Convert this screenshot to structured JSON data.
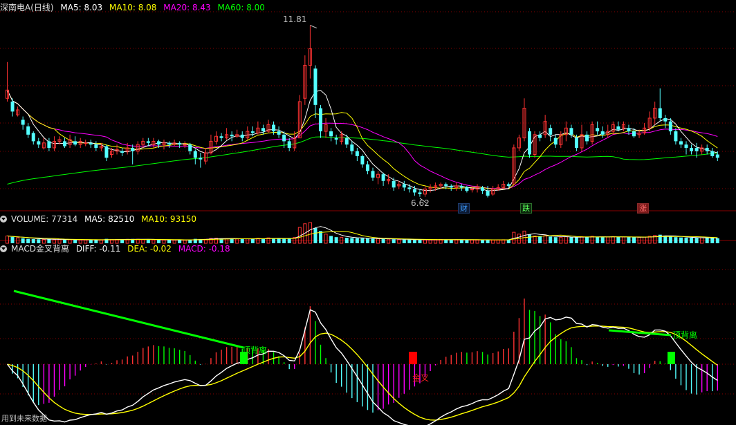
{
  "headers": {
    "kline": {
      "title": "深南电A(日线)",
      "ma5": "MA5: 8.03",
      "ma10": "MA10: 8.08",
      "ma20": "MA20: 8.43",
      "ma60": "MA60: 8.00"
    },
    "volume": {
      "title": "VOLUME: 77314",
      "ma5": "MA5: 82510",
      "ma10": "MA10: 93150"
    },
    "macd": {
      "title": "MACD金叉背离",
      "diff": "DIFF: -0.11",
      "dea": "DEA: -0.02",
      "macd": "MACD: -0.18"
    }
  },
  "annotations": {
    "high": "11.81",
    "low": "6.62",
    "tag_cai": "财",
    "tag_die": "跌",
    "tag_zhang": "涨",
    "top_divergence_1": "顶背离",
    "top_divergence_2": "顶背离",
    "golden_cross": "金叉"
  },
  "footer": "用到未来数据",
  "colors": {
    "up": "#ff3232",
    "down": "#54ffff",
    "ma5": "#ffffff",
    "ma10": "#ffff00",
    "ma20": "#ff00ff",
    "ma60": "#00ff00",
    "grid": "#8b0000",
    "divergence": "#00ff00",
    "golden_cross": "#ff0000"
  },
  "chart_data": {
    "type": "candlestick",
    "price_range": [
      6.3,
      12.2
    ],
    "candles": [
      [
        9.6,
        9.85,
        10.7,
        9.5
      ],
      [
        9.5,
        9.2,
        9.6,
        9.05
      ],
      [
        9.1,
        9.25,
        9.35,
        9.05
      ],
      [
        8.95,
        8.8,
        9.05,
        8.65
      ],
      [
        8.75,
        8.5,
        8.85,
        8.4
      ],
      [
        8.55,
        8.3,
        8.6,
        8.2
      ],
      [
        8.3,
        8.2,
        8.4,
        8.1
      ],
      [
        8.1,
        8.25,
        8.4,
        8.05
      ],
      [
        8.3,
        8.1,
        8.4,
        8.0
      ],
      [
        8.1,
        8.3,
        8.45,
        8.0
      ],
      [
        8.3,
        8.35,
        8.45,
        8.2
      ],
      [
        8.3,
        8.15,
        8.4,
        8.1
      ],
      [
        8.2,
        8.35,
        8.5,
        8.1
      ],
      [
        8.3,
        8.2,
        8.45,
        8.15
      ],
      [
        8.2,
        8.3,
        8.4,
        8.1
      ],
      [
        8.25,
        8.25,
        8.35,
        8.15
      ],
      [
        8.25,
        8.2,
        8.35,
        8.1
      ],
      [
        8.2,
        8.1,
        8.3,
        8.0
      ],
      [
        8.1,
        8.15,
        8.25,
        8.0
      ],
      [
        8.15,
        7.8,
        8.2,
        7.7
      ],
      [
        7.9,
        8.0,
        8.1,
        7.8
      ],
      [
        8.0,
        8.05,
        8.2,
        7.9
      ],
      [
        8.0,
        7.95,
        8.1,
        7.85
      ],
      [
        8.0,
        8.1,
        8.25,
        7.9
      ],
      [
        8.1,
        8.0,
        8.2,
        7.6
      ],
      [
        8.0,
        8.2,
        8.3,
        7.9
      ],
      [
        8.2,
        8.3,
        8.4,
        8.1
      ],
      [
        8.3,
        8.25,
        8.4,
        8.15
      ],
      [
        8.2,
        8.3,
        8.4,
        8.1
      ],
      [
        8.3,
        8.2,
        8.35,
        8.1
      ],
      [
        8.2,
        8.25,
        8.35,
        8.05
      ],
      [
        8.25,
        8.2,
        8.3,
        8.1
      ],
      [
        8.2,
        8.25,
        8.35,
        8.15
      ],
      [
        8.25,
        8.2,
        8.3,
        8.1
      ],
      [
        8.2,
        8.2,
        8.3,
        8.1
      ],
      [
        8.2,
        8.0,
        8.25,
        7.9
      ],
      [
        8.0,
        7.8,
        8.05,
        7.6
      ],
      [
        7.8,
        7.75,
        7.95,
        7.5
      ],
      [
        7.7,
        7.95,
        8.1,
        7.6
      ],
      [
        7.95,
        8.3,
        8.5,
        7.9
      ],
      [
        8.3,
        8.45,
        8.6,
        8.2
      ],
      [
        8.45,
        8.4,
        8.55,
        8.3
      ],
      [
        8.4,
        8.5,
        8.7,
        8.35
      ],
      [
        8.5,
        8.45,
        8.6,
        8.3
      ],
      [
        8.45,
        8.5,
        8.65,
        8.4
      ],
      [
        8.5,
        8.4,
        8.6,
        8.3
      ],
      [
        8.4,
        8.6,
        8.75,
        8.35
      ],
      [
        8.6,
        8.55,
        8.75,
        8.45
      ],
      [
        8.55,
        8.7,
        8.9,
        8.5
      ],
      [
        8.7,
        8.6,
        8.8,
        8.5
      ],
      [
        8.6,
        8.8,
        8.95,
        8.55
      ],
      [
        8.8,
        8.6,
        8.9,
        8.5
      ],
      [
        8.6,
        8.5,
        8.75,
        8.4
      ],
      [
        8.5,
        8.3,
        8.6,
        8.1
      ],
      [
        8.3,
        8.1,
        8.4,
        8.0
      ],
      [
        8.1,
        8.4,
        8.6,
        8.0
      ],
      [
        8.4,
        9.5,
        9.7,
        8.4
      ],
      [
        9.6,
        10.6,
        10.9,
        9.4
      ],
      [
        10.6,
        11.1,
        11.81,
        10.2
      ],
      [
        10.5,
        9.4,
        10.6,
        9.0
      ],
      [
        9.3,
        8.6,
        9.4,
        8.4
      ],
      [
        8.6,
        8.8,
        9.0,
        8.4
      ],
      [
        8.6,
        8.45,
        8.7,
        8.3
      ],
      [
        8.4,
        8.35,
        8.5,
        8.2
      ],
      [
        8.3,
        8.5,
        8.6,
        8.2
      ],
      [
        8.4,
        8.2,
        8.5,
        8.1
      ],
      [
        8.2,
        8.0,
        8.3,
        7.9
      ],
      [
        8.0,
        7.85,
        8.1,
        7.7
      ],
      [
        7.85,
        7.6,
        7.9,
        7.5
      ],
      [
        7.6,
        7.4,
        7.7,
        7.3
      ],
      [
        7.4,
        7.2,
        7.5,
        7.1
      ],
      [
        7.2,
        7.3,
        7.4,
        7.0
      ],
      [
        7.3,
        7.1,
        7.35,
        6.95
      ],
      [
        7.1,
        7.15,
        7.3,
        7.0
      ],
      [
        7.1,
        6.9,
        7.2,
        6.8
      ],
      [
        6.95,
        7.0,
        7.1,
        6.85
      ],
      [
        7.0,
        6.9,
        7.1,
        6.8
      ],
      [
        6.9,
        6.85,
        7.0,
        6.75
      ],
      [
        6.85,
        6.75,
        6.95,
        6.65
      ],
      [
        6.75,
        6.7,
        6.85,
        6.62
      ],
      [
        6.7,
        6.85,
        6.95,
        6.62
      ],
      [
        6.85,
        6.9,
        7.0,
        6.75
      ],
      [
        6.9,
        6.95,
        7.05,
        6.8
      ],
      [
        6.95,
        7.0,
        7.05,
        6.85
      ],
      [
        7.0,
        6.95,
        7.05,
        6.85
      ],
      [
        6.95,
        6.9,
        7.0,
        6.8
      ],
      [
        6.9,
        6.95,
        7.05,
        6.8
      ],
      [
        6.95,
        6.9,
        7.0,
        6.8
      ],
      [
        6.9,
        6.8,
        6.95,
        6.75
      ],
      [
        6.85,
        6.85,
        6.95,
        6.75
      ],
      [
        6.85,
        6.9,
        7.0,
        6.75
      ],
      [
        6.9,
        6.8,
        6.95,
        6.7
      ],
      [
        6.8,
        6.65,
        6.95,
        6.6
      ],
      [
        6.7,
        6.85,
        6.95,
        6.65
      ],
      [
        6.85,
        6.9,
        7.0,
        6.8
      ],
      [
        6.9,
        7.0,
        7.1,
        6.85
      ],
      [
        7.0,
        6.95,
        7.05,
        6.9
      ],
      [
        7.0,
        8.1,
        8.2,
        7.0
      ],
      [
        8.1,
        8.4,
        8.5,
        8.0
      ],
      [
        8.4,
        9.3,
        9.6,
        8.3
      ],
      [
        8.6,
        7.9,
        8.7,
        7.8
      ],
      [
        7.9,
        8.5,
        8.6,
        7.8
      ],
      [
        8.5,
        8.4,
        8.6,
        8.3
      ],
      [
        8.5,
        8.9,
        9.1,
        8.4
      ],
      [
        8.7,
        8.5,
        8.8,
        8.3
      ],
      [
        8.4,
        8.2,
        8.5,
        8.1
      ],
      [
        8.2,
        8.5,
        8.6,
        8.1
      ],
      [
        8.5,
        8.7,
        8.9,
        8.3
      ],
      [
        8.7,
        8.5,
        8.8,
        8.4
      ],
      [
        8.4,
        8.1,
        8.5,
        8.0
      ],
      [
        8.1,
        8.5,
        8.8,
        8.0
      ],
      [
        8.5,
        8.3,
        8.6,
        8.2
      ],
      [
        8.3,
        8.8,
        8.9,
        8.2
      ],
      [
        8.7,
        8.6,
        8.9,
        8.5
      ],
      [
        8.6,
        8.5,
        8.75,
        8.4
      ],
      [
        8.5,
        8.6,
        8.8,
        8.4
      ],
      [
        8.6,
        8.8,
        8.9,
        8.5
      ],
      [
        8.75,
        8.65,
        8.9,
        8.6
      ],
      [
        8.7,
        8.8,
        8.9,
        8.6
      ],
      [
        8.7,
        8.6,
        8.8,
        8.5
      ],
      [
        8.6,
        8.45,
        8.7,
        8.4
      ],
      [
        8.5,
        8.55,
        8.65,
        8.4
      ],
      [
        8.55,
        8.7,
        8.85,
        8.5
      ],
      [
        8.7,
        9.0,
        9.2,
        8.6
      ],
      [
        9.0,
        9.3,
        9.5,
        8.8
      ],
      [
        9.3,
        9.0,
        9.9,
        8.9
      ],
      [
        9.0,
        8.9,
        9.1,
        8.7
      ],
      [
        8.9,
        8.6,
        9.0,
        8.5
      ],
      [
        8.6,
        8.3,
        8.7,
        8.2
      ],
      [
        8.3,
        8.2,
        8.4,
        8.1
      ],
      [
        8.2,
        8.1,
        8.3,
        7.9
      ],
      [
        8.1,
        8.0,
        8.2,
        7.9
      ],
      [
        8.1,
        8.0,
        8.25,
        7.8
      ],
      [
        8.0,
        8.1,
        8.2,
        7.9
      ],
      [
        8.1,
        8.0,
        8.2,
        7.9
      ],
      [
        8.0,
        7.85,
        8.1,
        7.8
      ],
      [
        7.9,
        7.8,
        8.0,
        7.7
      ]
    ],
    "volume": [
      12000,
      10500,
      9000,
      8000,
      7200,
      6800,
      6500,
      6200,
      6600,
      6000,
      6300,
      5900,
      6100,
      5800,
      5700,
      5600,
      5500,
      5400,
      5800,
      7200,
      6000,
      6200,
      6100,
      6400,
      7000,
      6500,
      6200,
      6000,
      5800,
      5700,
      5600,
      5500,
      5400,
      5300,
      5200,
      6000,
      7200,
      6800,
      6500,
      8000,
      8500,
      8000,
      7600,
      7200,
      7000,
      6800,
      7400,
      7000,
      8200,
      7600,
      8800,
      8000,
      7600,
      7400,
      7800,
      9500,
      26000,
      32000,
      34000,
      25000,
      20000,
      15000,
      12000,
      10000,
      9800,
      9000,
      8500,
      8200,
      8000,
      7800,
      7500,
      7200,
      7000,
      6800,
      6500,
      6300,
      6100,
      6000,
      5800,
      5600,
      5800,
      5900,
      6000,
      6100,
      6000,
      5900,
      5800,
      5700,
      5600,
      5700,
      5800,
      5600,
      5500,
      5600,
      5700,
      5800,
      5700,
      18000,
      15000,
      20000,
      14000,
      12000,
      11000,
      12500,
      11000,
      10000,
      9800,
      10500,
      9800,
      9500,
      11000,
      10000,
      11500,
      10500,
      10000,
      10200,
      11000,
      10500,
      10200,
      9800,
      9600,
      9800,
      10200,
      11500,
      12800,
      14000,
      12000,
      11000,
      10000,
      9500,
      9200,
      9000,
      8800,
      9000,
      8800,
      8500,
      8200
    ],
    "macd_hist_range": [
      -0.9,
      0.9
    ],
    "diff_dea_range": [
      -0.75,
      0.8
    ]
  }
}
